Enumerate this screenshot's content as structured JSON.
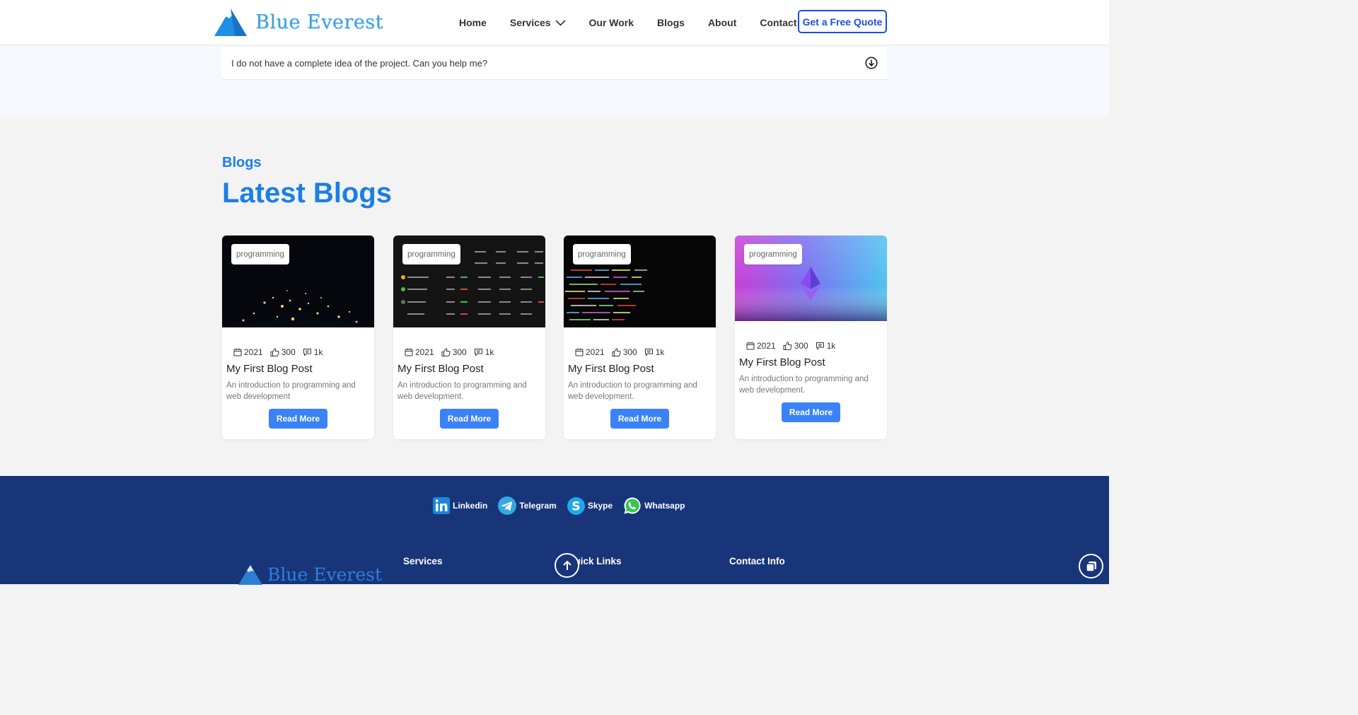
{
  "brand": {
    "name": "Blue Everest"
  },
  "nav": {
    "items": [
      "Home",
      "Services",
      "Our Work",
      "Blogs",
      "About",
      "Contact"
    ],
    "cta": "Get a Free Quote"
  },
  "faq": {
    "question": "I do not have a complete idea of the project. Can you help me?"
  },
  "blogs": {
    "kicker": "Blogs",
    "title": "Latest Blogs",
    "cards": [
      {
        "tag": "programming",
        "year": "2021",
        "likes": "300",
        "comments": "1k",
        "title": "My First Blog Post",
        "desc": "An introduction to programming and web development",
        "button": "Read More"
      },
      {
        "tag": "programming",
        "year": "2021",
        "likes": "300",
        "comments": "1k",
        "title": "My First Blog Post",
        "desc": "An introduction to programming and web development.",
        "button": "Read More"
      },
      {
        "tag": "programming",
        "year": "2021",
        "likes": "300",
        "comments": "1k",
        "title": "My First Blog Post",
        "desc": "An introduction to programming and web development.",
        "button": "Read More"
      },
      {
        "tag": "programming",
        "year": "2021",
        "likes": "300",
        "comments": "1k",
        "title": "My First Blog Post",
        "desc": "An introduction to programming and web development.",
        "button": "Read More"
      }
    ]
  },
  "footer": {
    "socials": [
      "Linkedin",
      "Telegram",
      "Skype",
      "Whatsapp"
    ],
    "headings": {
      "services": "Services",
      "quick_links": "Quick Links",
      "contact": "Contact Info"
    },
    "brand_name": "Blue Everest"
  },
  "colors": {
    "accent": "#1a7ee6",
    "button": "#3b82f6",
    "footer_bg": "#18357a",
    "cta_border": "#1d4ed8"
  }
}
